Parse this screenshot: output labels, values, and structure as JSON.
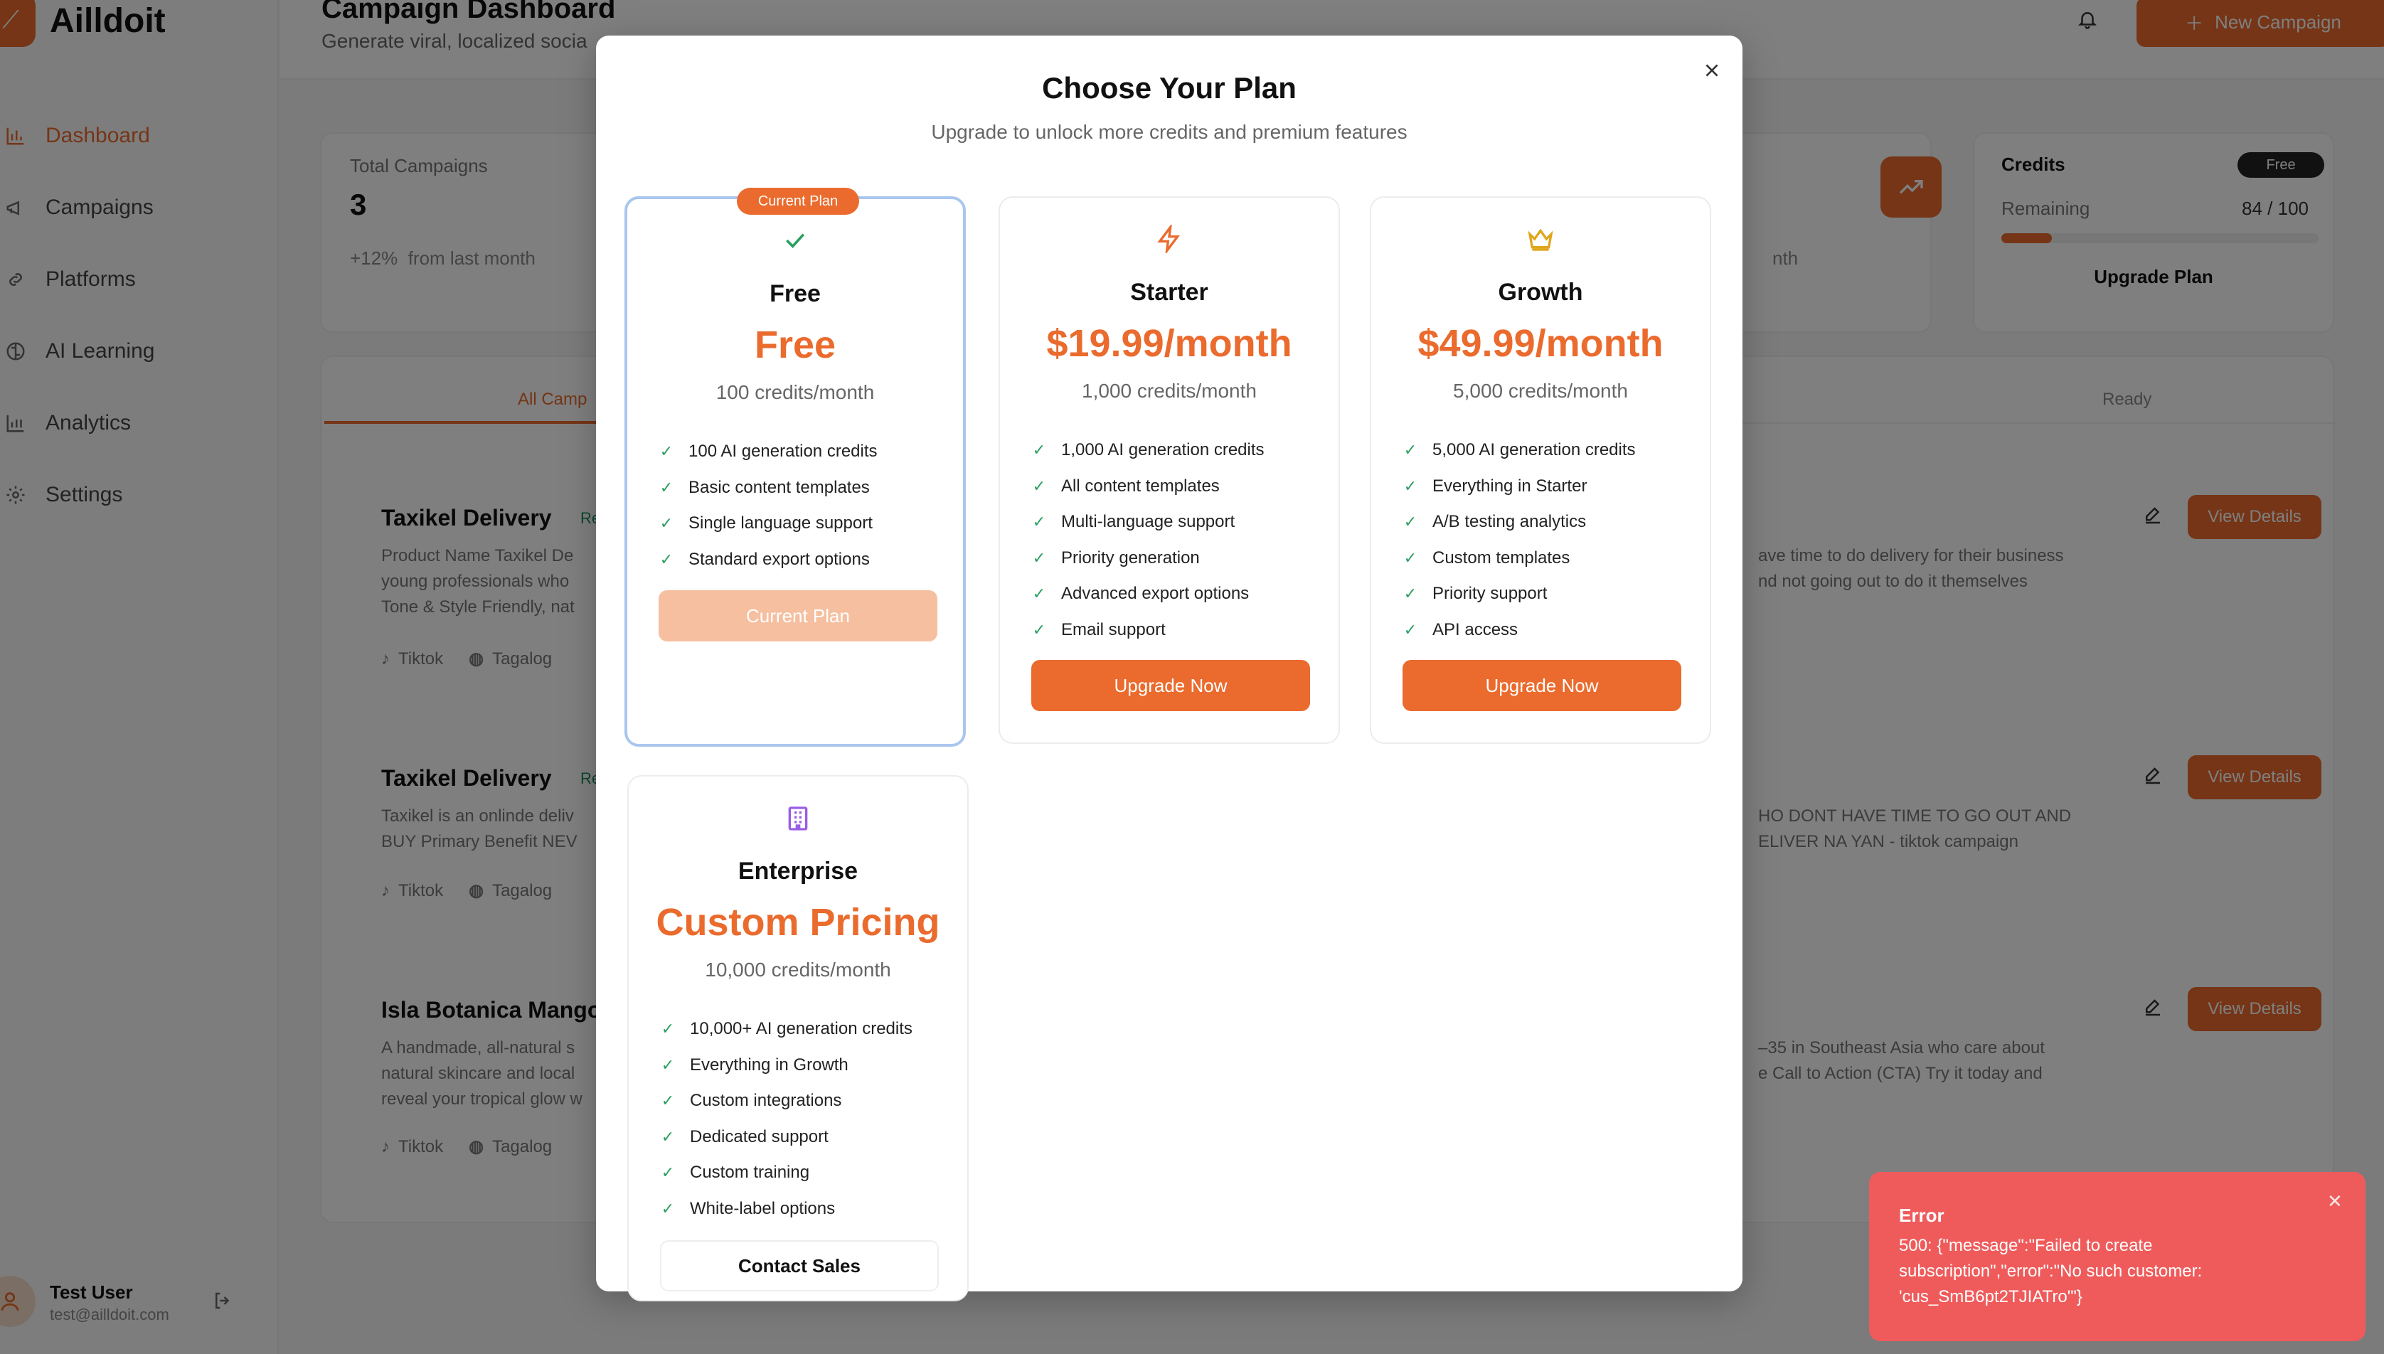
{
  "app": {
    "name": "Ailldoit",
    "logo_glyph": "⟋"
  },
  "sidebar": {
    "items": [
      {
        "label": "Dashboard",
        "icon": "bar-chart-icon",
        "active": true
      },
      {
        "label": "Campaigns",
        "icon": "megaphone-icon"
      },
      {
        "label": "Platforms",
        "icon": "link-icon"
      },
      {
        "label": "AI Learning",
        "icon": "brain-icon"
      },
      {
        "label": "Analytics",
        "icon": "analytics-icon"
      },
      {
        "label": "Settings",
        "icon": "gear-icon"
      }
    ],
    "user": {
      "name": "Test User",
      "email": "test@ailldoit.com"
    }
  },
  "header": {
    "title": "Campaign Dashboard",
    "subtitle": "Generate viral, localized socia",
    "new_button": "New Campaign"
  },
  "stats": {
    "total_label": "Total Campaigns",
    "total_value": "3",
    "change_pct": "+12%",
    "change_text": "from last month",
    "change_tail": "nth"
  },
  "credits": {
    "label": "Credits",
    "badge": "Free",
    "remaining_label": "Remaining",
    "remaining_value": "84 / 100",
    "fill_fraction": 0.16,
    "upgrade": "Upgrade Plan"
  },
  "tabs": {
    "left": "All Camp",
    "right": "Ready"
  },
  "campaigns": [
    {
      "title": "Taxikel Delivery",
      "badge": "Re",
      "left_lines": [
        "Product Name Taxikel De",
        "young professionals who",
        "Tone & Style Friendly, nat"
      ],
      "right_lines": [
        "ave time to do delivery for their business",
        "nd not going out to do it themselves"
      ],
      "platform": "Tiktok",
      "language": "Tagalog",
      "view": "View Details"
    },
    {
      "title": "Taxikel Delivery",
      "badge": "Re",
      "left_lines": [
        "Taxikel is an onlinde deliv",
        "BUY Primary Benefit NEV"
      ],
      "right_lines": [
        "HO DONT HAVE TIME TO GO OUT AND",
        "ELIVER NA YAN - tiktok campaign"
      ],
      "platform": "Tiktok",
      "language": "Tagalog",
      "view": "View Details"
    },
    {
      "title": "Isla Botanica Mango",
      "left_lines": [
        "A handmade, all-natural s",
        "natural skincare and local",
        "reveal your tropical glow w"
      ],
      "right_lines": [
        "–35 in Southeast Asia who care about",
        "e Call to Action (CTA) Try it today and"
      ],
      "platform": "Tiktok",
      "language": "Tagalog",
      "view": "View Details"
    }
  ],
  "modal": {
    "title": "Choose Your Plan",
    "subtitle": "Upgrade to unlock more credits and premium features",
    "current_badge": "Current Plan",
    "plans": [
      {
        "name": "Free",
        "price": "Free",
        "credits": "100 credits/month",
        "icon": "check-icon",
        "features": [
          "100 AI generation credits",
          "Basic content templates",
          "Single language support",
          "Standard export options"
        ],
        "button": "Current Plan"
      },
      {
        "name": "Starter",
        "price": "$19.99/month",
        "credits": "1,000 credits/month",
        "icon": "lightning-icon",
        "features": [
          "1,000 AI generation credits",
          "All content templates",
          "Multi-language support",
          "Priority generation",
          "Advanced export options",
          "Email support"
        ],
        "button": "Upgrade Now"
      },
      {
        "name": "Growth",
        "price": "$49.99/month",
        "credits": "5,000 credits/month",
        "icon": "crown-icon",
        "features": [
          "5,000 AI generation credits",
          "Everything in Starter",
          "A/B testing analytics",
          "Custom templates",
          "Priority support",
          "API access"
        ],
        "button": "Upgrade Now"
      },
      {
        "name": "Enterprise",
        "price": "Custom Pricing",
        "credits": "10,000 credits/month",
        "icon": "building-icon",
        "features": [
          "10,000+ AI generation credits",
          "Everything in Growth",
          "Custom integrations",
          "Dedicated support",
          "Custom training",
          "White-label options"
        ],
        "button": "Contact Sales"
      }
    ]
  },
  "toast": {
    "title": "Error",
    "message": "500: {\"message\":\"Failed to create subscription\",\"error\":\"No such customer: 'cus_SmB6pt2TJIATro'\"}"
  },
  "colors": {
    "accent": "#ea6b2d",
    "error": "#ef5b5b",
    "success": "#2aa060",
    "current_border": "#a9c6ee"
  }
}
